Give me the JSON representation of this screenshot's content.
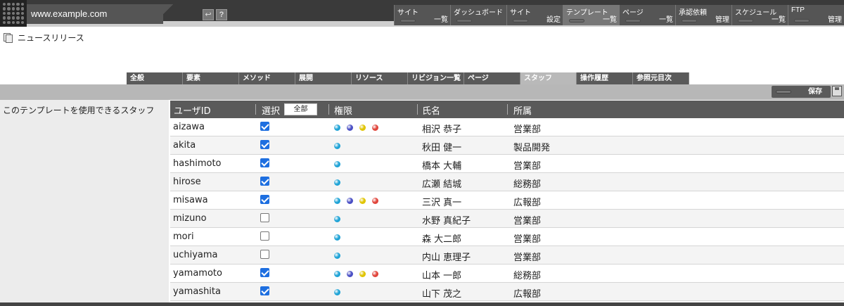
{
  "header": {
    "url": "www.example.com",
    "help_label": "?"
  },
  "nav": [
    {
      "top": "サイト",
      "bottom": "一覧"
    },
    {
      "top": "ダッシュボード",
      "bottom": ""
    },
    {
      "top": "サイト",
      "bottom": "設定"
    },
    {
      "top": "テンプレート",
      "bottom": "一覧",
      "active": true
    },
    {
      "top": "ページ",
      "bottom": "一覧"
    },
    {
      "top": "承認依頼",
      "bottom": "管理"
    },
    {
      "top": "スケジュール",
      "bottom": "一覧"
    },
    {
      "top": "FTP",
      "bottom": "管理"
    }
  ],
  "page": {
    "title": "ニュースリリース",
    "side_label": "このテンプレートを使用できるスタッフ"
  },
  "tabs": [
    {
      "label": "全般"
    },
    {
      "label": "要素"
    },
    {
      "label": "メソッド"
    },
    {
      "label": "展開"
    },
    {
      "label": "リソース"
    },
    {
      "label": "リビジョン一覧"
    },
    {
      "label": "ページ"
    },
    {
      "label": "スタッフ",
      "active": true
    },
    {
      "label": "操作履歴"
    },
    {
      "label": "参照元目次"
    }
  ],
  "toolbar": {
    "save_label": "保存"
  },
  "table": {
    "columns": {
      "user_id": "ユーザID",
      "select": "選択",
      "select_all": "全部",
      "permission": "権限",
      "name": "氏名",
      "department": "所属"
    },
    "dot_colors": [
      "#1fa3d6",
      "#4a4fc4",
      "#e0c400",
      "#e0443a"
    ],
    "rows": [
      {
        "id": "aizawa",
        "selected": true,
        "perms": 4,
        "name": "相沢 恭子",
        "dept": "営業部"
      },
      {
        "id": "akita",
        "selected": true,
        "perms": 1,
        "name": "秋田 健一",
        "dept": "製品開発"
      },
      {
        "id": "hashimoto",
        "selected": true,
        "perms": 1,
        "name": "橋本 大輔",
        "dept": "営業部"
      },
      {
        "id": "hirose",
        "selected": true,
        "perms": 1,
        "name": "広瀬 結城",
        "dept": "総務部"
      },
      {
        "id": "misawa",
        "selected": true,
        "perms": 4,
        "name": "三沢 真一",
        "dept": "広報部"
      },
      {
        "id": "mizuno",
        "selected": false,
        "perms": 1,
        "name": "水野 真紀子",
        "dept": "営業部"
      },
      {
        "id": "mori",
        "selected": false,
        "perms": 1,
        "name": "森 大二郎",
        "dept": "営業部"
      },
      {
        "id": "uchiyama",
        "selected": false,
        "perms": 1,
        "name": "内山 恵理子",
        "dept": "営業部"
      },
      {
        "id": "yamamoto",
        "selected": true,
        "perms": 4,
        "name": "山本 一郎",
        "dept": "総務部"
      },
      {
        "id": "yamashita",
        "selected": true,
        "perms": 1,
        "name": "山下 茂之",
        "dept": "広報部"
      }
    ]
  }
}
